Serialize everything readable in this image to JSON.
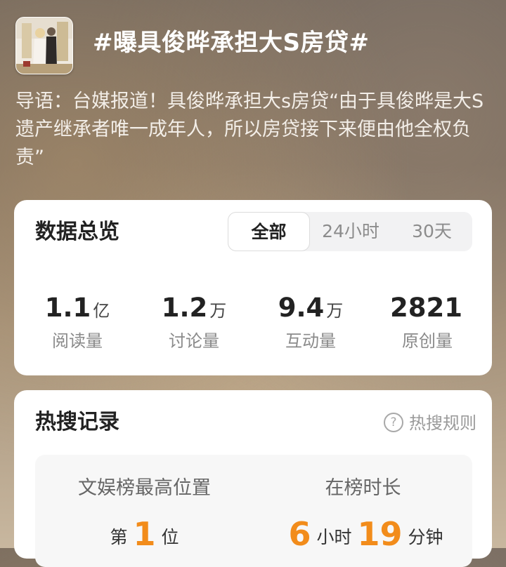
{
  "topic": {
    "title": "#曝具俊晔承担大S房贷#",
    "intro": "导语：台媒报道！具俊晔承担大s房贷“由于具俊晔是大S遗产继承者唯一成年人，所以房贷接下来便由他全权负责”"
  },
  "overview": {
    "title": "数据总览",
    "tabs": [
      {
        "label": "全部",
        "active": true
      },
      {
        "label": "24小时",
        "active": false
      },
      {
        "label": "30天",
        "active": false
      }
    ],
    "stats": [
      {
        "value": "1.1",
        "unit": "亿",
        "label": "阅读量"
      },
      {
        "value": "1.2",
        "unit": "万",
        "label": "讨论量"
      },
      {
        "value": "9.4",
        "unit": "万",
        "label": "互动量"
      },
      {
        "value": "2821",
        "unit": "",
        "label": "原创量"
      }
    ]
  },
  "hot_search": {
    "title": "热搜记录",
    "rules_label": "热搜规则",
    "rules_icon": "question-circle-icon",
    "highest_rank": {
      "label": "文娱榜最高位置",
      "prefix": "第",
      "number": "1",
      "suffix": "位"
    },
    "duration": {
      "label": "在榜时长",
      "hours": "6",
      "hours_unit": "小时",
      "minutes": "19",
      "minutes_unit": "分钟"
    }
  },
  "colors": {
    "accent": "#f28c1b",
    "card_bg": "#ffffff",
    "title_text": "#ffffff"
  }
}
